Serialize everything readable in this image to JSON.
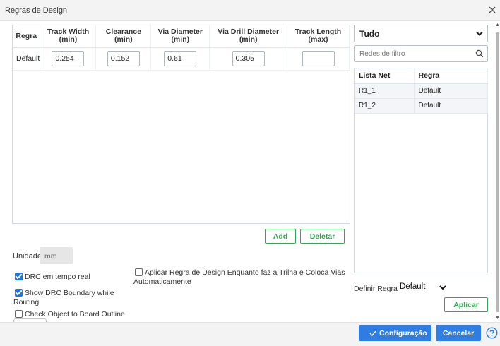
{
  "window": {
    "title": "Regras de Design"
  },
  "rules_table": {
    "headers": [
      {
        "line1": "Regra",
        "line2": ""
      },
      {
        "line1": "Track Width",
        "line2": "(min)"
      },
      {
        "line1": "Clearance",
        "line2": "(min)"
      },
      {
        "line1": "Via Diameter",
        "line2": "(min)"
      },
      {
        "line1": "Via Drill Diameter",
        "line2": "(min)"
      },
      {
        "line1": "Track Length",
        "line2": "(max)"
      }
    ],
    "rows": [
      {
        "name": "Default",
        "track_width": "0.254",
        "clearance": "0.152",
        "via_diameter": "0.61",
        "via_drill_diameter": "0.305",
        "track_length": ""
      }
    ]
  },
  "buttons": {
    "add": "Add",
    "delete": "Deletar",
    "apply": "Aplicar",
    "config": "Configuração",
    "cancel": "Cancelar"
  },
  "unit": {
    "label": "Unidade",
    "value": "mm"
  },
  "options": {
    "drc_realtime": {
      "label": "DRC em tempo real",
      "checked": true
    },
    "show_drc_boundary": {
      "label_line1": "Show DRC Boundary while",
      "label_line2": "Routing",
      "checked": true
    },
    "check_board_outline": {
      "label": "Check Object to Board Outline",
      "checked": false
    },
    "apply_rule_auto": {
      "label_line1": "Aplicar Regra de Design Enquanto faz a Trilha e Coloca Vias",
      "label_line2": "Automaticamente",
      "checked": false
    }
  },
  "net_filter": {
    "selected": "Tudo",
    "placeholder": "Redes de filtro",
    "headers": {
      "net": "Lista Net",
      "rule": "Regra"
    },
    "rows": [
      {
        "net": "R1_1",
        "rule": "Default"
      },
      {
        "net": "R1_2",
        "rule": "Default"
      }
    ]
  },
  "rule_definition": {
    "label": "Definir Regra",
    "selected": "Default"
  },
  "colors": {
    "primary": "#2f7de1",
    "accent_green": "#2fa84f",
    "checkbox": "#1a73e8"
  },
  "icons": {
    "close": "close-icon",
    "chevron": "chevron-down-icon",
    "search": "search-icon",
    "check": "check-icon",
    "help": "help-icon"
  }
}
